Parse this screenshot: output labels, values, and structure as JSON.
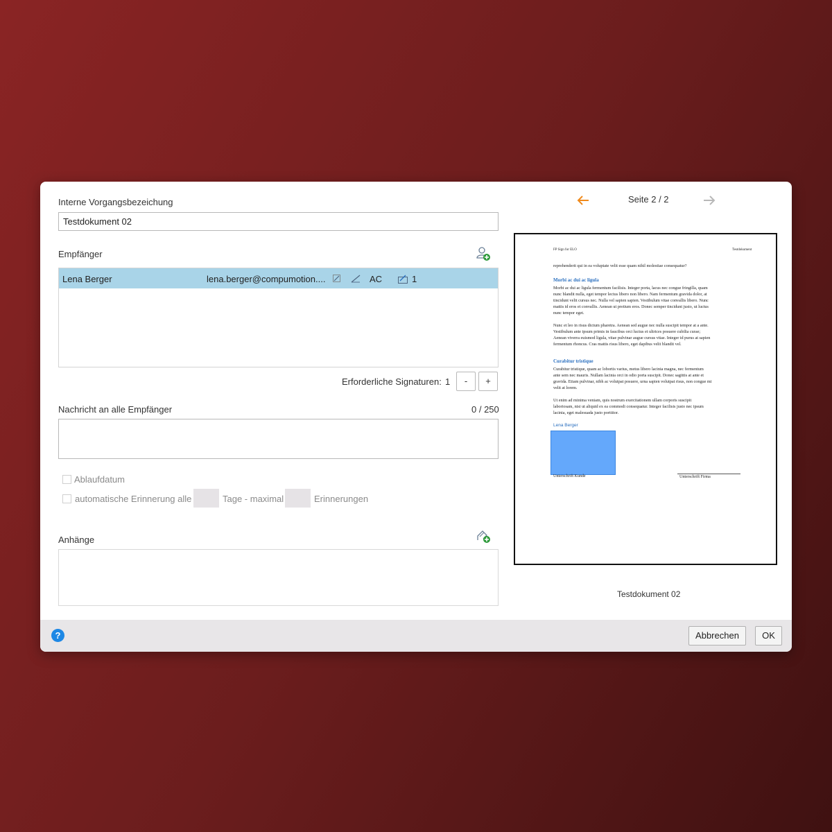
{
  "form": {
    "title_label": "Interne Vorgangsbezeichung",
    "title_value": "Testdokument 02",
    "recipients_label": "Empfänger",
    "recipients": [
      {
        "name": "Lena Berger",
        "email": "lena.berger@compumotion....",
        "initials": "AC",
        "count": "1"
      }
    ],
    "required_sig_label": "Erforderliche Signaturen:",
    "required_sig_value": "1",
    "minus_label": "-",
    "plus_label": "+",
    "message_label": "Nachricht an alle Empfänger",
    "message_counter": "0 / 250",
    "expiry_label": "Ablaufdatum",
    "reminder_label": "automatische Erinnerung alle",
    "days_label": "Tage  - maximal",
    "reminders_label": "Erinnerungen",
    "attachments_label": "Anhänge"
  },
  "preview": {
    "page_label": "Seite 2 / 2",
    "doc_name": "Testdokument 02",
    "header_left": "FP Sign for ELO",
    "header_right": "Testdokument",
    "intro": "reprehenderit qui in ea voluptate velit esse quam nihil molestiae consequatur?",
    "heading1": "Morbi ac dui ac ligula",
    "para1a": "Morbi ac dui ac ligula fermentum facilisis. Integer porta, lacus nec congue fringilla, quam",
    "para1b": "nunc blandit nulla, eget tempor lectus libero non libero. Nam fermentum gravida dolor, at",
    "para1c": "tincidunt velit cursus nec. Nulla vel sapien sapien. Vestibulum vitae convallis libero. Nunc",
    "para1d": "mattis id eros et convallis. Aenean ut pretium eros. Donec semper tincidunt justo, ut luctus",
    "para1e": "nunc tempor eget.",
    "para2a": "Nunc et leo in risus dictum pharetra. Aenean sed augue nec nulla suscipit tempor at a ante.",
    "para2b": "Vestibulum ante ipsum primis in faucibus orci luctus et ultrices posuere cubilia curae;",
    "para2c": "Aenean viverra euismod ligula, vitae pulvinar augue cursus vitae. Integer id purus at sapien",
    "para2d": "fermentum rhoncus. Cras mattis risus libero, eget dapibus velit blandit vel.",
    "heading2": "Curabitur tristique",
    "para3a": "Curabitur tristique, quam ac lobortis varius, metus libero lacinia magna, nec fermentum",
    "para3b": "ante sem nec mauris. Nullam lacinia orci in odio porta suscipit. Donec sagittis at ante et",
    "para3c": "gravida. Etiam pulvinar, nibh ac volutpat posuere, urna sapien volutpat risus, non congue mi",
    "para3d": "velit at lorem.",
    "para4a": "Ut enim ad minima veniam, quis nostrum exercitationem ullam corporis suscipit",
    "para4b": "laboriosam, nisi ut aliquid ex ea commodi consequatur. Integer facilisis justo nec ipsum",
    "para4c": "lacinia, eget malesuada justo porttitor.",
    "signer_label": "Lena Berger",
    "sig_customer": "Unterschrift Kunde",
    "sig_company": "Unterschrift Firma"
  },
  "footer": {
    "help": "?",
    "cancel": "Abbrechen",
    "ok": "OK"
  },
  "colors": {
    "row_highlight": "#a9d4e8",
    "accent_orange": "#f08a1c",
    "signature_field": "#64a8fb",
    "help_blue": "#1e88e5"
  }
}
